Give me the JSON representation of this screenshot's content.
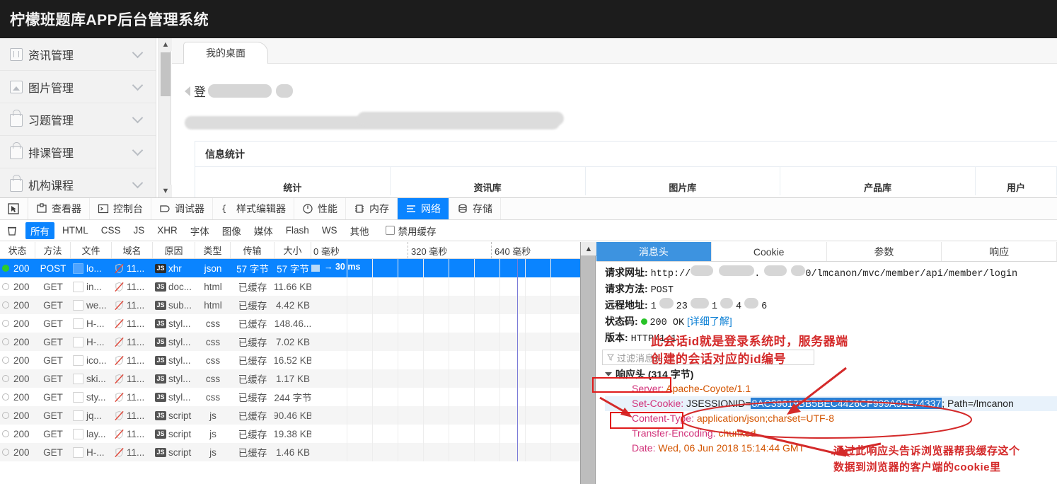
{
  "app": {
    "title": "柠檬班题库APP后台管理系统"
  },
  "sidebar": {
    "items": [
      {
        "label": "资讯管理",
        "icon": "book-icon"
      },
      {
        "label": "图片管理",
        "icon": "image-icon"
      },
      {
        "label": "习题管理",
        "icon": "lock-icon"
      },
      {
        "label": "排课管理",
        "icon": "lock-icon"
      },
      {
        "label": "机构课程",
        "icon": "lock-icon"
      }
    ]
  },
  "page": {
    "tab_label": "我的桌面",
    "login_text": "登",
    "panel_title": "信息统计",
    "stat_headers": [
      "统计",
      "资讯库",
      "图片库",
      "产品库",
      "用户"
    ]
  },
  "devtools": {
    "tabs": [
      {
        "label": "查看器",
        "icon": "inspector-icon",
        "active": false
      },
      {
        "label": "控制台",
        "icon": "console-icon",
        "active": false
      },
      {
        "label": "调试器",
        "icon": "debugger-icon",
        "active": false
      },
      {
        "label": "样式编辑器",
        "icon": "style-editor-icon",
        "active": false
      },
      {
        "label": "性能",
        "icon": "performance-icon",
        "active": false
      },
      {
        "label": "内存",
        "icon": "memory-icon",
        "active": false
      },
      {
        "label": "网络",
        "icon": "network-icon",
        "active": true
      },
      {
        "label": "存储",
        "icon": "storage-icon",
        "active": false
      }
    ],
    "filters": [
      "所有",
      "HTML",
      "CSS",
      "JS",
      "XHR",
      "字体",
      "图像",
      "媒体",
      "Flash",
      "WS",
      "其他"
    ],
    "active_filter": "所有",
    "disable_cache_label": "禁用缓存",
    "disable_cache_checked": false,
    "columns": [
      "状态",
      "方法",
      "文件",
      "域名",
      "原因",
      "类型",
      "传输",
      "大小"
    ],
    "timeline_ticks": [
      "0 毫秒",
      "320 毫秒",
      "640 毫秒"
    ],
    "rows": [
      {
        "status": "200",
        "method": "POST",
        "file": "lo...",
        "domain": "11...",
        "cause": "xhr",
        "type": "json",
        "transferred": "57 字节",
        "size": "57 字节",
        "time": "→ 30 ms",
        "selected": true
      },
      {
        "status": "200",
        "method": "GET",
        "file": "in...",
        "domain": "11...",
        "cause": "doc...",
        "type": "html",
        "transferred": "已缓存",
        "size": "11.66 KB",
        "time": "",
        "selected": false
      },
      {
        "status": "200",
        "method": "GET",
        "file": "we...",
        "domain": "11...",
        "cause": "sub...",
        "type": "html",
        "transferred": "已缓存",
        "size": "4.42 KB",
        "time": "",
        "selected": false
      },
      {
        "status": "200",
        "method": "GET",
        "file": "H-...",
        "domain": "11...",
        "cause": "styl...",
        "type": "css",
        "transferred": "已缓存",
        "size": "148.46...",
        "time": "",
        "selected": false
      },
      {
        "status": "200",
        "method": "GET",
        "file": "H-...",
        "domain": "11...",
        "cause": "styl...",
        "type": "css",
        "transferred": "已缓存",
        "size": "7.02 KB",
        "time": "",
        "selected": false
      },
      {
        "status": "200",
        "method": "GET",
        "file": "ico...",
        "domain": "11...",
        "cause": "styl...",
        "type": "css",
        "transferred": "已缓存",
        "size": "16.52 KB",
        "time": "",
        "selected": false
      },
      {
        "status": "200",
        "method": "GET",
        "file": "ski...",
        "domain": "11...",
        "cause": "styl...",
        "type": "css",
        "transferred": "已缓存",
        "size": "1.17 KB",
        "time": "",
        "selected": false
      },
      {
        "status": "200",
        "method": "GET",
        "file": "sty...",
        "domain": "11...",
        "cause": "styl...",
        "type": "css",
        "transferred": "已缓存",
        "size": "244 字节",
        "time": "",
        "selected": false
      },
      {
        "status": "200",
        "method": "GET",
        "file": "jq...",
        "domain": "11...",
        "cause": "script",
        "type": "js",
        "transferred": "已缓存",
        "size": "90.46 KB",
        "time": "",
        "selected": false
      },
      {
        "status": "200",
        "method": "GET",
        "file": "lay...",
        "domain": "11...",
        "cause": "script",
        "type": "js",
        "transferred": "已缓存",
        "size": "19.38 KB",
        "time": "",
        "selected": false
      },
      {
        "status": "200",
        "method": "GET",
        "file": "H-...",
        "domain": "11...",
        "cause": "script",
        "type": "js",
        "transferred": "已缓存",
        "size": "1.46 KB",
        "time": "",
        "selected": false
      }
    ]
  },
  "details": {
    "tabs": [
      {
        "label": "消息头",
        "active": true
      },
      {
        "label": "Cookie",
        "active": false
      },
      {
        "label": "参数",
        "active": false
      },
      {
        "label": "响应",
        "active": false
      }
    ],
    "request": {
      "url_label": "请求网址:",
      "url_prefix": "http://",
      "url_suffix": "0/lmcanon/mvc/member/api/member/login",
      "method_label": "请求方法:",
      "method_value": "POST",
      "remote_label": "远程地址:",
      "remote_value_parts": [
        "1",
        "23",
        "1",
        "4",
        "6"
      ],
      "status_label": "状态码:",
      "status_value": "200 OK",
      "status_link": "[详细了解]",
      "version_label": "版本:",
      "version_value": "HTTP/1.1"
    },
    "filter_placeholder": "过滤消息头",
    "response_headers_title": "响应头 (314 字节)",
    "headers": [
      {
        "name": "Server",
        "value": "Apache-Coyote/1.1"
      },
      {
        "name": "Set-Cookie",
        "value": "JSESSIONID=8AC39619BB5BEC4426CF999A92E74337; Path=/lmcanon",
        "highlight": "8AC39619BB5BEC4426CF999A92E74337",
        "selected": true
      },
      {
        "name": "Content-Type",
        "value": "application/json;charset=UTF-8"
      },
      {
        "name": "Transfer-Encoding",
        "value": "chunked"
      },
      {
        "name": "Date",
        "value": "Wed, 06 Jun 2018 15:14:44 GMT"
      }
    ]
  },
  "annotations": [
    {
      "id": "session-note",
      "line1": "此会话id就是登录系统时，服务器端",
      "line2": "创建的会话对应的id编号"
    },
    {
      "id": "cache-note",
      "line1": "通过此响应头告诉浏览器帮我缓存这个",
      "line2": "数据到浏览器的客户端的cookie里"
    }
  ],
  "colors": {
    "accent": "#0a84ff",
    "annotation": "#d42a2a",
    "header_bg": "#1c1c1c",
    "status_ok": "#28c328"
  }
}
